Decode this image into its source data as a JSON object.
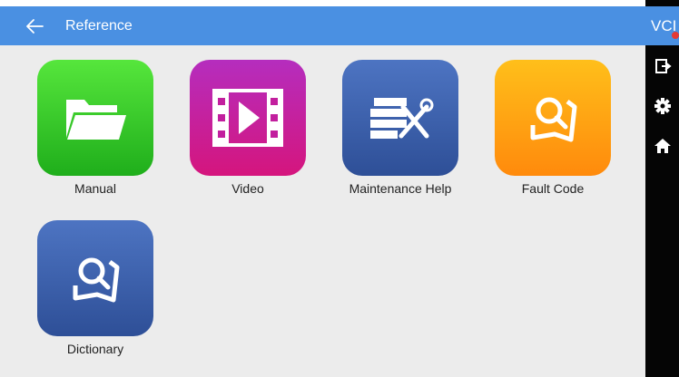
{
  "header": {
    "title": "Reference",
    "back_icon": "arrow-left-icon"
  },
  "sidebar": {
    "vci_label": "VCI",
    "status_color": "#e53935",
    "items": [
      {
        "name": "exit",
        "icon": "exit-icon"
      },
      {
        "name": "settings",
        "icon": "gear-icon"
      },
      {
        "name": "home",
        "icon": "home-icon"
      }
    ]
  },
  "tiles": [
    {
      "label": "Manual",
      "icon": "folder-icon",
      "color": "#2fc42a"
    },
    {
      "label": "Video",
      "icon": "film-play-icon",
      "color": "#c21f9e"
    },
    {
      "label": "Maintenance Help",
      "icon": "tools-icon",
      "color": "#3a5faa"
    },
    {
      "label": "Fault Code",
      "icon": "search-book-icon",
      "color": "#ffa413"
    },
    {
      "label": "Dictionary",
      "icon": "search-book-icon",
      "color": "#3a5faa"
    }
  ],
  "colors": {
    "header": "#4a90e2",
    "sidebar": "#050505",
    "background": "#ececec"
  }
}
